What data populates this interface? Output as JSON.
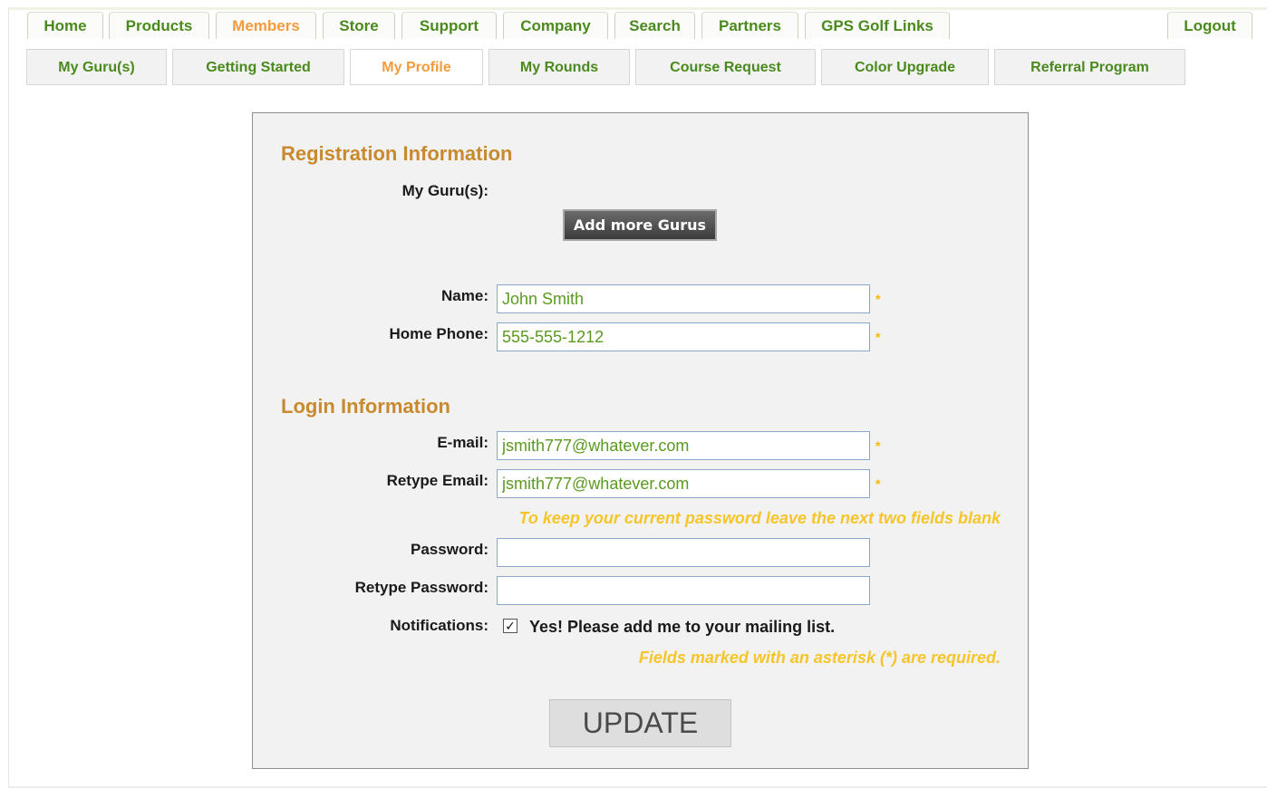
{
  "top_nav": {
    "tabs": [
      "Home",
      "Products",
      "Members",
      "Store",
      "Support",
      "Company",
      "Search",
      "Partners",
      "GPS Golf Links"
    ],
    "logout": "Logout"
  },
  "sub_nav": {
    "tabs": [
      "My Guru(s)",
      "Getting Started",
      "My Profile",
      "My Rounds",
      "Course Request",
      "Color Upgrade",
      "Referral Program"
    ]
  },
  "registration": {
    "title": "Registration Information",
    "gurus_label": "My Guru(s):",
    "add_gurus_button": "Add more Gurus",
    "name_label": "Name:",
    "name_value": "John Smith",
    "phone_label": "Home Phone:",
    "phone_value": "555-555-1212"
  },
  "login": {
    "title": "Login Information",
    "email_label": "E-mail:",
    "email_value": "jsmith777@whatever.com",
    "retype_email_label": "Retype Email:",
    "retype_email_value": "jsmith777@whatever.com",
    "password_hint": "To keep your current password leave the next two fields blank",
    "password_label": "Password:",
    "password_value": "",
    "retype_password_label": "Retype Password:",
    "retype_password_value": "",
    "notifications_label": "Notifications:",
    "notifications_checked": true,
    "notifications_text": "Yes! Please add me to your mailing list.",
    "required_note": "Fields marked with an asterisk (*) are required.",
    "asterisk": "*",
    "update_button": "UPDATE"
  },
  "colors": {
    "nav_green": "#4a8a1c",
    "active_orange": "#f59a3c",
    "section_title": "#c98a2e",
    "hint_yellow": "#f5c52a"
  }
}
